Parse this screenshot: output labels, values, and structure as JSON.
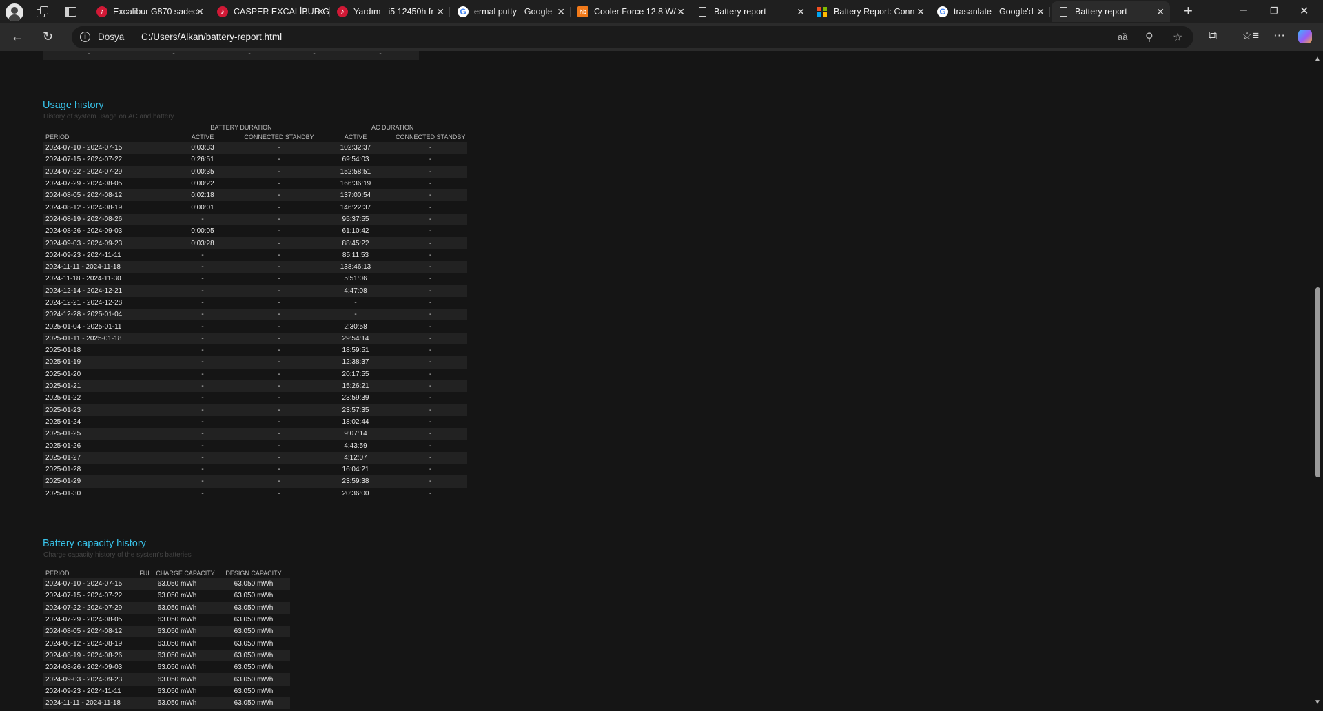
{
  "browser": {
    "tabs": [
      {
        "title": "Excalibur G870 sadece",
        "favicon": "tiktok",
        "left": 0
      },
      {
        "title": "CASPER EXCALİBUR G",
        "favicon": "tiktok"
      },
      {
        "title": "Yardım - i5 12450h fr",
        "favicon": "tiktok"
      },
      {
        "title": "ermal putty - Google",
        "favicon": "google"
      },
      {
        "title": "Cooler Force 12.8 W/",
        "favicon": "hb"
      },
      {
        "title": "Battery report",
        "favicon": "page"
      },
      {
        "title": "Battery Report: Conn",
        "favicon": "microsoft"
      },
      {
        "title": "trasanlate - Google'd",
        "favicon": "google"
      },
      {
        "title": "Battery report",
        "favicon": "page",
        "active": true
      }
    ],
    "address": {
      "scheme_label": "Dosya",
      "url": "C:/Users/Alkan/battery-report.html"
    }
  },
  "report": {
    "top_row": [
      "-",
      "-",
      "-",
      "-",
      "-"
    ],
    "usage": {
      "title": "Usage history",
      "subtitle": "History of system usage on AC and battery",
      "group_headers": {
        "battery": "BATTERY DURATION",
        "ac": "AC DURATION"
      },
      "columns": [
        "PERIOD",
        "ACTIVE",
        "CONNECTED STANDBY",
        "ACTIVE",
        "CONNECTED STANDBY"
      ],
      "rows": [
        [
          "2024-07-10 - 2024-07-15",
          "0:03:33",
          "-",
          "102:32:37",
          "-"
        ],
        [
          "2024-07-15 - 2024-07-22",
          "0:26:51",
          "-",
          "69:54:03",
          "-"
        ],
        [
          "2024-07-22 - 2024-07-29",
          "0:00:35",
          "-",
          "152:58:51",
          "-"
        ],
        [
          "2024-07-29 - 2024-08-05",
          "0:00:22",
          "-",
          "166:36:19",
          "-"
        ],
        [
          "2024-08-05 - 2024-08-12",
          "0:02:18",
          "-",
          "137:00:54",
          "-"
        ],
        [
          "2024-08-12 - 2024-08-19",
          "0:00:01",
          "-",
          "146:22:37",
          "-"
        ],
        [
          "2024-08-19 - 2024-08-26",
          "-",
          "-",
          "95:37:55",
          "-"
        ],
        [
          "2024-08-26 - 2024-09-03",
          "0:00:05",
          "-",
          "61:10:42",
          "-"
        ],
        [
          "2024-09-03 - 2024-09-23",
          "0:03:28",
          "-",
          "88:45:22",
          "-"
        ],
        [
          "2024-09-23 - 2024-11-11",
          "-",
          "-",
          "85:11:53",
          "-"
        ],
        [
          "2024-11-11 - 2024-11-18",
          "-",
          "-",
          "138:46:13",
          "-"
        ],
        [
          "2024-11-18 - 2024-11-30",
          "-",
          "-",
          "5:51:06",
          "-"
        ],
        [
          "2024-12-14 - 2024-12-21",
          "-",
          "-",
          "4:47:08",
          "-"
        ],
        [
          "2024-12-21 - 2024-12-28",
          "-",
          "-",
          "-",
          "-"
        ],
        [
          "2024-12-28 - 2025-01-04",
          "-",
          "-",
          "-",
          "-"
        ],
        [
          "2025-01-04 - 2025-01-11",
          "-",
          "-",
          "2:30:58",
          "-"
        ],
        [
          "2025-01-11 - 2025-01-18",
          "-",
          "-",
          "29:54:14",
          "-"
        ],
        [
          "2025-01-18",
          "-",
          "-",
          "18:59:51",
          "-"
        ],
        [
          "2025-01-19",
          "-",
          "-",
          "12:38:37",
          "-"
        ],
        [
          "2025-01-20",
          "-",
          "-",
          "20:17:55",
          "-"
        ],
        [
          "2025-01-21",
          "-",
          "-",
          "15:26:21",
          "-"
        ],
        [
          "2025-01-22",
          "-",
          "-",
          "23:59:39",
          "-"
        ],
        [
          "2025-01-23",
          "-",
          "-",
          "23:57:35",
          "-"
        ],
        [
          "2025-01-24",
          "-",
          "-",
          "18:02:44",
          "-"
        ],
        [
          "2025-01-25",
          "-",
          "-",
          "9:07:14",
          "-"
        ],
        [
          "2025-01-26",
          "-",
          "-",
          "4:43:59",
          "-"
        ],
        [
          "2025-01-27",
          "-",
          "-",
          "4:12:07",
          "-"
        ],
        [
          "2025-01-28",
          "-",
          "-",
          "16:04:21",
          "-"
        ],
        [
          "2025-01-29",
          "-",
          "-",
          "23:59:38",
          "-"
        ],
        [
          "2025-01-30",
          "-",
          "-",
          "20:36:00",
          "-"
        ]
      ]
    },
    "capacity": {
      "title": "Battery capacity history",
      "subtitle": "Charge capacity history of the system's batteries",
      "columns": [
        "PERIOD",
        "FULL CHARGE CAPACITY",
        "DESIGN CAPACITY"
      ],
      "rows": [
        [
          "2024-07-10 - 2024-07-15",
          "63.050 mWh",
          "63.050 mWh"
        ],
        [
          "2024-07-15 - 2024-07-22",
          "63.050 mWh",
          "63.050 mWh"
        ],
        [
          "2024-07-22 - 2024-07-29",
          "63.050 mWh",
          "63.050 mWh"
        ],
        [
          "2024-07-29 - 2024-08-05",
          "63.050 mWh",
          "63.050 mWh"
        ],
        [
          "2024-08-05 - 2024-08-12",
          "63.050 mWh",
          "63.050 mWh"
        ],
        [
          "2024-08-12 - 2024-08-19",
          "63.050 mWh",
          "63.050 mWh"
        ],
        [
          "2024-08-19 - 2024-08-26",
          "63.050 mWh",
          "63.050 mWh"
        ],
        [
          "2024-08-26 - 2024-09-03",
          "63.050 mWh",
          "63.050 mWh"
        ],
        [
          "2024-09-03 - 2024-09-23",
          "63.050 mWh",
          "63.050 mWh"
        ],
        [
          "2024-09-23 - 2024-11-11",
          "63.050 mWh",
          "63.050 mWh"
        ],
        [
          "2024-11-11 - 2024-11-18",
          "63.050 mWh",
          "63.050 mWh"
        ]
      ]
    }
  }
}
